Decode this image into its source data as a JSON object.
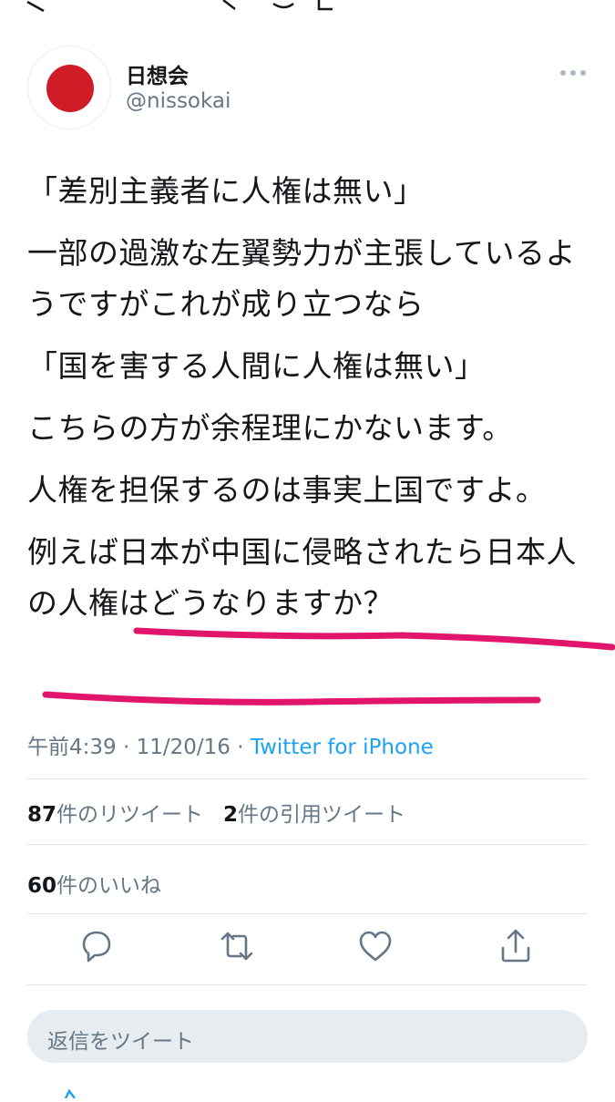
{
  "user": {
    "display_name": "日想会",
    "handle": "@nissokai"
  },
  "tweet": {
    "paragraphs": [
      "「差別主義者に人権は無い」",
      "一部の過激な左翼勢力が主張しているようですがこれが成り立つなら",
      "「国を害する人間に人権は無い」",
      "こちらの方が余程理にかないます。",
      "人権を担保するのは事実上国ですよ。",
      "例えば日本が中国に侵略されたら日本人の人権はどうなりますか？"
    ],
    "highlight_color": "#e0156b"
  },
  "meta": {
    "time": "午前4:39",
    "separator": " · ",
    "date": "11/20/16",
    "source": "Twitter for iPhone"
  },
  "stats": {
    "retweets_count": "87",
    "retweets_label": "件のリツイート",
    "quotes_count": "2",
    "quotes_label": "件の引用ツイート",
    "likes_count": "60",
    "likes_label": "件のいいね"
  },
  "actions": {
    "reply_icon": "reply-icon",
    "retweet_icon": "retweet-icon",
    "like_icon": "heart-icon",
    "share_icon": "share-icon"
  },
  "reply": {
    "placeholder": "返信をツイート"
  },
  "colors": {
    "link": "#1da1f2",
    "secondary_text": "#657786",
    "flag_red": "#cf1c27"
  }
}
